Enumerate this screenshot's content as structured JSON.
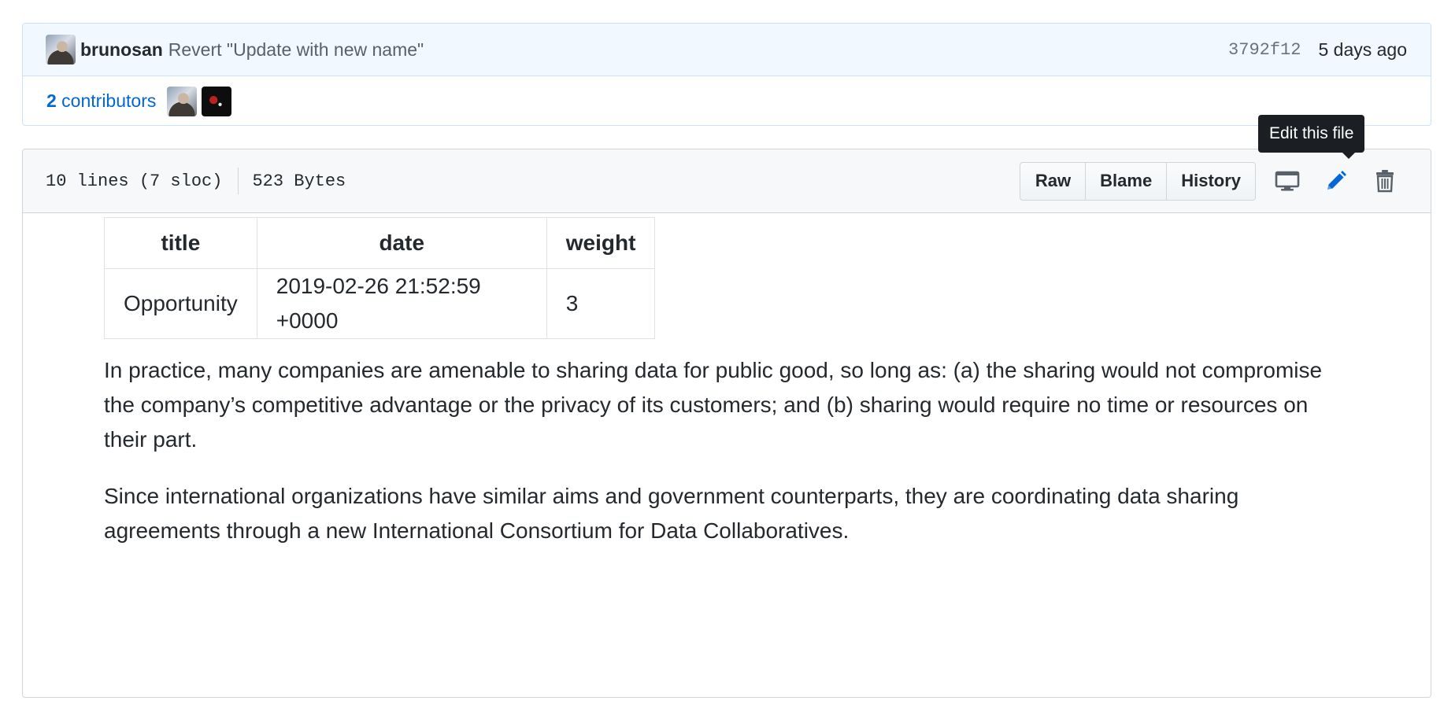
{
  "commit": {
    "author": "brunosan",
    "message": "Revert \"Update with new name\"",
    "sha": "3792f12",
    "date": "5 days ago"
  },
  "contributors": {
    "count": "2",
    "label": " contributors"
  },
  "file": {
    "lines": "10 lines (7 sloc)",
    "size": "523 Bytes",
    "buttons": {
      "raw": "Raw",
      "blame": "Blame",
      "history": "History"
    },
    "tooltip": "Edit this file"
  },
  "content": {
    "table": {
      "headers": [
        "title",
        "date",
        "weight"
      ],
      "rows": [
        [
          "Opportunity",
          "2019-02-26 21:52:59 +0000",
          "3"
        ]
      ]
    },
    "paragraphs": [
      "In practice, many companies are amenable to sharing data for public good, so long as: (a) the sharing would not compromise the company’s competitive advantage or the privacy of its customers; and (b) sharing would require no time or resources on their part.",
      "Since international organizations have similar aims and government counterparts, they are coordinating data sharing agreements through a new International Consortium for Data Collaboratives."
    ]
  },
  "colors": {
    "link": "#0366d6",
    "commit_bg": "#f1f8ff",
    "header_bg": "#f6f8fa",
    "tooltip_bg": "#1b1f23"
  },
  "icons": [
    "desktop-icon",
    "pencil-icon",
    "trashcan-icon"
  ]
}
